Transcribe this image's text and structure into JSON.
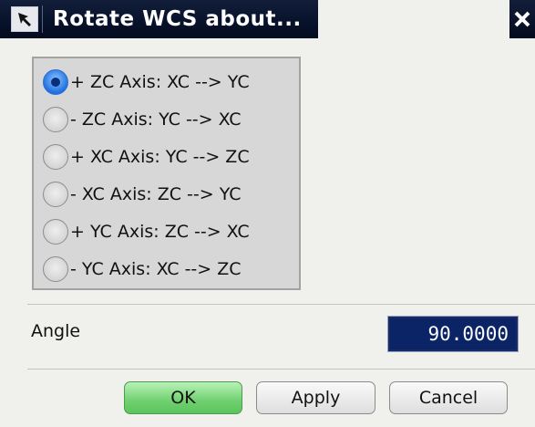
{
  "dialog": {
    "title": "Rotate WCS about..."
  },
  "options": [
    {
      "label": "+ ZC Axis:  XC --> YC",
      "checked": true
    },
    {
      "label": "- ZC Axis:  YC --> XC",
      "checked": false
    },
    {
      "label": "+ XC Axis:  YC --> ZC",
      "checked": false
    },
    {
      "label": "- XC Axis:  ZC --> YC",
      "checked": false
    },
    {
      "label": "+ YC Axis:  ZC --> XC",
      "checked": false
    },
    {
      "label": "- YC Axis:  XC --> ZC",
      "checked": false
    }
  ],
  "angle": {
    "label": "Angle",
    "value": "90.0000"
  },
  "buttons": {
    "ok": "OK",
    "apply": "Apply",
    "cancel": "Cancel"
  },
  "colors": {
    "titlebar": "#07112a",
    "ok_button": "#6fd06f",
    "angle_field": "#0b2466"
  }
}
